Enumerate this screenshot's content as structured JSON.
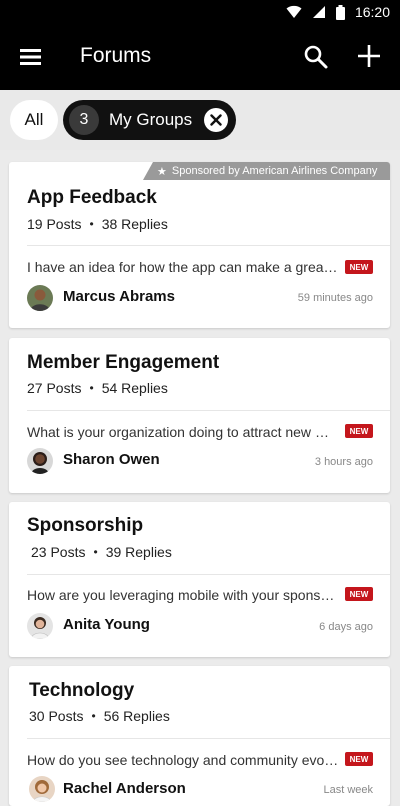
{
  "status_bar": {
    "time": "16:20",
    "icons": [
      "wifi-icon",
      "signal-icon",
      "battery-icon"
    ]
  },
  "app_bar": {
    "title": "Forums",
    "icons": [
      "menu-icon",
      "search-icon",
      "add-icon"
    ]
  },
  "filters": {
    "all_label": "All",
    "groups_count": "3",
    "groups_label": "My Groups"
  },
  "sponsor_label": "Sponsored by American Airlines Company",
  "new_label": "NEW",
  "stats_separator": "•",
  "colors": {
    "accent": "#c4161c",
    "bar": "#000000",
    "sponsor": "#9a9a9a"
  },
  "forums": [
    {
      "name": "App Feedback",
      "posts": "19 Posts",
      "replies": "38 Replies",
      "preview": "I have an idea for how the app can make a great impact",
      "author": "Marcus Abrams",
      "time": "59 minutes ago"
    },
    {
      "name": "Member Engagement",
      "posts": "27 Posts",
      "replies": "54 Replies",
      "preview": "What is your organization doing to attract new members?",
      "author": "Sharon Owen",
      "time": "3 hours ago"
    },
    {
      "name": "Sponsorship",
      "posts": "23 Posts",
      "replies": "39 Replies",
      "preview": "How are you leveraging mobile with your sponsors?",
      "author": "Anita Young",
      "time": "6 days ago"
    },
    {
      "name": "Technology",
      "posts": "30 Posts",
      "replies": "56 Replies",
      "preview": "How do you see technology and community evolving?",
      "author": "Rachel Anderson",
      "time": "Last week"
    }
  ]
}
